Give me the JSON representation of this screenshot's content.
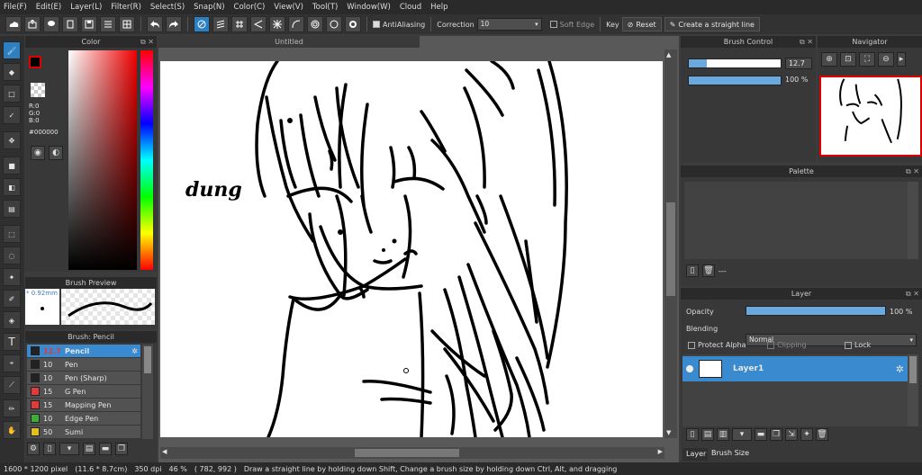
{
  "menu": [
    "File(F)",
    "Edit(E)",
    "Layer(L)",
    "Filter(R)",
    "Select(S)",
    "Snap(N)",
    "Color(C)",
    "View(V)",
    "Tool(T)",
    "Window(W)",
    "Cloud",
    "Help"
  ],
  "toolbar": {
    "antialiasing": "AntiAliasing",
    "correction_label": "Correction",
    "correction_value": "10",
    "soft_edge": "Soft Edge",
    "key_label": "Key",
    "reset": "Reset",
    "straight_line": "Create a straight line"
  },
  "color_panel": {
    "title": "Color",
    "r": "R:0",
    "g": "G:0",
    "b": "B:0",
    "hex": "#000000"
  },
  "brush_preview": {
    "title": "Brush Preview",
    "size": "* 0.92mm"
  },
  "brush_list": {
    "title": "Brush: Pencil",
    "items": [
      {
        "size": "12.7",
        "name": "Pencil",
        "color": "#222222"
      },
      {
        "size": "10",
        "name": "Pen",
        "color": "#222222"
      },
      {
        "size": "10",
        "name": "Pen (Sharp)",
        "color": "#222222"
      },
      {
        "size": "15",
        "name": "G Pen",
        "color": "#e03a3a"
      },
      {
        "size": "15",
        "name": "Mapping Pen",
        "color": "#e03a3a"
      },
      {
        "size": "10",
        "name": "Edge Pen",
        "color": "#3ab03a"
      },
      {
        "size": "50",
        "name": "Sumi",
        "color": "#e0c020"
      }
    ]
  },
  "canvas": {
    "tab": "Untitled",
    "signature": "dung"
  },
  "status": {
    "size": "1600 * 1200 pixel",
    "phys": "(11.6 * 8.7cm)",
    "dpi": "350 dpi",
    "zoom": "46 %",
    "coords": "( 782, 992 )",
    "hint": "Draw a straight line by holding down Shift, Change a brush size by holding down Ctrl, Alt, and dragging"
  },
  "brush_control": {
    "title": "Brush Control",
    "size_value": "12.7",
    "opacity_value": "100 %",
    "size_fraction": 0.2,
    "opacity_fraction": 1.0
  },
  "navigator": {
    "title": "Navigator"
  },
  "palette": {
    "title": "Palette",
    "dash": "---"
  },
  "layer_panel": {
    "title": "Layer",
    "opacity_label": "Opacity",
    "opacity_value": "100 %",
    "blending_label": "Blending",
    "blending_value": "Normal",
    "protect_alpha": "Protect Alpha",
    "clipping": "Clipping",
    "lock": "Lock",
    "layer_name": "Layer1",
    "tab_layer": "Layer",
    "tab_brush_size": "Brush Size"
  }
}
